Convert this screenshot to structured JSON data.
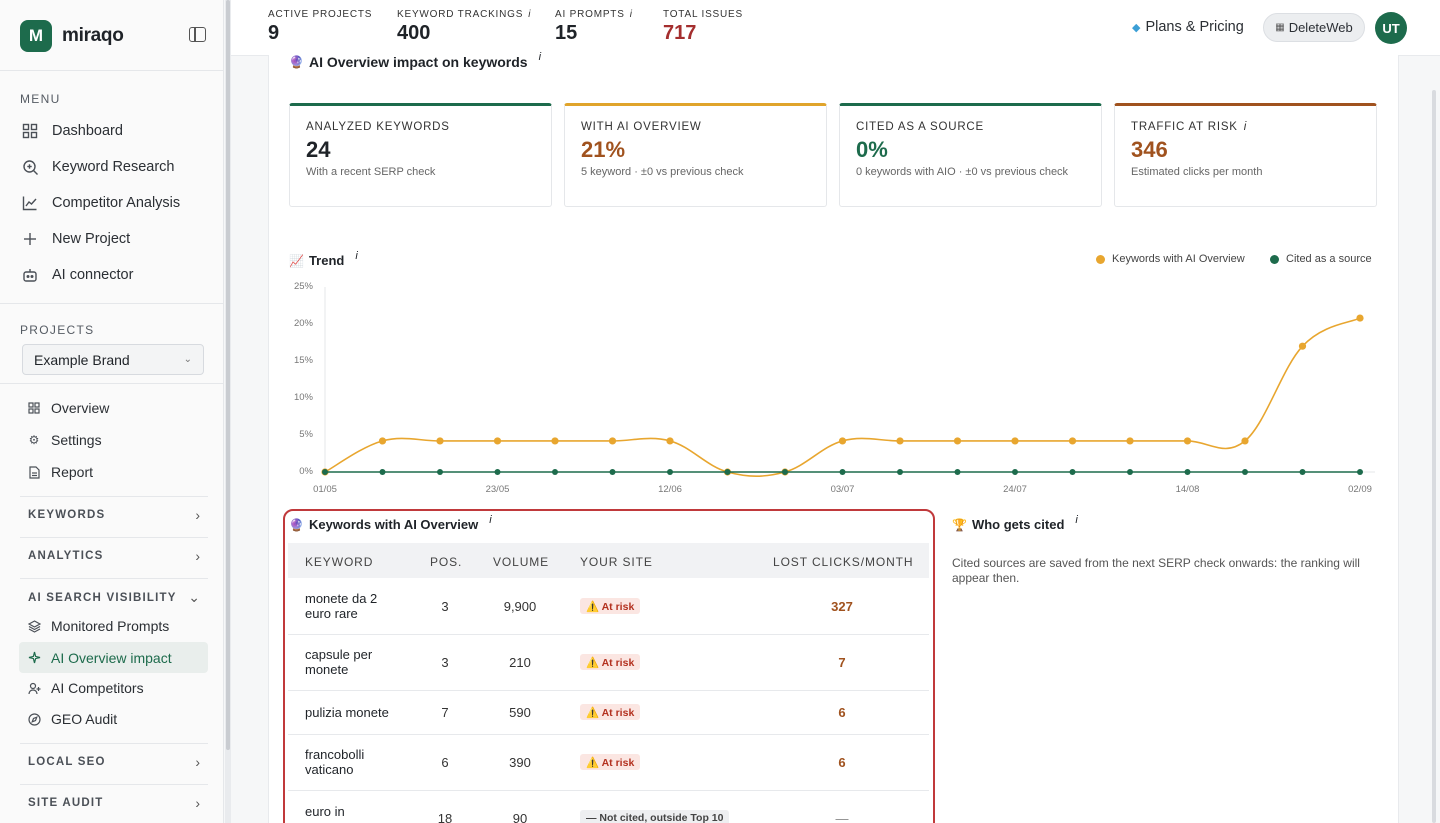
{
  "brand": {
    "name": "miraqo",
    "logo_letter": "M"
  },
  "sidebar": {
    "menu_title": "MENU",
    "menu": [
      {
        "label": "Dashboard",
        "icon": "grid-icon"
      },
      {
        "label": "Keyword Research",
        "icon": "search-icon"
      },
      {
        "label": "Competitor Analysis",
        "icon": "chart-line-icon"
      },
      {
        "label": "New Project",
        "icon": "plus-icon"
      },
      {
        "label": "AI connector",
        "icon": "robot-icon"
      }
    ],
    "projects_title": "PROJECTS",
    "project_select": "Example Brand",
    "project_items": [
      {
        "label": "Overview",
        "icon": "grid-icon"
      },
      {
        "label": "Settings",
        "icon": "gear-icon"
      },
      {
        "label": "Report",
        "icon": "document-icon"
      }
    ],
    "groups": {
      "keywords": "KEYWORDS",
      "analytics": "ANALYTICS",
      "ai_visibility": "AI SEARCH VISIBILITY",
      "local_seo": "LOCAL SEO",
      "site_audit": "SITE AUDIT"
    },
    "ai_items": [
      {
        "label": "Monitored Prompts",
        "icon": "layers-icon"
      },
      {
        "label": "AI Overview impact",
        "icon": "sparkle-icon"
      },
      {
        "label": "AI Competitors",
        "icon": "user-plus-icon"
      },
      {
        "label": "GEO Audit",
        "icon": "compass-icon"
      }
    ]
  },
  "header": {
    "stats": [
      {
        "label": "ACTIVE PROJECTS",
        "value": "9"
      },
      {
        "label": "KEYWORD TRACKINGS",
        "value": "400",
        "info": "i"
      },
      {
        "label": "AI PROMPTS",
        "value": "15",
        "info": "i"
      },
      {
        "label": "TOTAL ISSUES",
        "value": "717"
      }
    ],
    "plans": "Plans & Pricing",
    "site": "DeleteWeb",
    "avatar": "UT"
  },
  "page": {
    "title": "AI Overview impact on keywords",
    "info": "i",
    "cards": [
      {
        "label": "ANALYZED KEYWORDS",
        "value": "24",
        "sub": "With a recent SERP check",
        "color": "#1d6b4c"
      },
      {
        "label": "WITH AI OVERVIEW",
        "value": "21%",
        "sub": "5 keyword · ±0   vs previous check",
        "color": "#e0a42b"
      },
      {
        "label": "CITED AS A SOURCE",
        "value": "0%",
        "sub": "0 keywords with AIO · ±0   vs previous check",
        "color": "#1d6b4c"
      },
      {
        "label": "TRAFFIC AT RISK",
        "value": "346",
        "sub": "Estimated clicks per month",
        "color": "#a0521e",
        "info": "i"
      }
    ]
  },
  "trend": {
    "title": "Trend",
    "info": "i",
    "legend": [
      "Keywords with AI Overview",
      "Cited as a source"
    ],
    "colors": {
      "aio": "#e8a62f",
      "cited": "#1d6b4c"
    }
  },
  "chart_data": {
    "type": "line",
    "title": "Trend",
    "x_tick_labels": [
      "01/05",
      "23/05",
      "12/06",
      "03/07",
      "24/07",
      "14/08",
      "02/09"
    ],
    "y_tick_labels": [
      "0%",
      "5%",
      "10%",
      "15%",
      "20%",
      "25%"
    ],
    "ylim": [
      0,
      25
    ],
    "series": [
      {
        "name": "Keywords with AI Overview",
        "values": [
          0,
          4.2,
          4.2,
          4.2,
          4.2,
          4.2,
          4.2,
          0,
          0,
          4.2,
          4.2,
          4.2,
          4.2,
          4.2,
          4.2,
          4.2,
          4.2,
          17,
          20.8
        ]
      },
      {
        "name": "Cited as a source",
        "values": [
          0,
          0,
          0,
          0,
          0,
          0,
          0,
          0,
          0,
          0,
          0,
          0,
          0,
          0,
          0,
          0,
          0,
          0,
          0
        ]
      }
    ]
  },
  "keywords_table": {
    "title": "Keywords with AI Overview",
    "info": "i",
    "columns": [
      "KEYWORD",
      "POS.",
      "VOLUME",
      "YOUR SITE",
      "LOST CLICKS/MONTH"
    ],
    "rows": [
      {
        "keyword": "monete da 2 euro rare",
        "pos": "3",
        "volume": "9,900",
        "status": "⚠️ At risk",
        "lost": "327"
      },
      {
        "keyword": "capsule per monete",
        "pos": "3",
        "volume": "210",
        "status": "⚠️ At risk",
        "lost": "7"
      },
      {
        "keyword": "pulizia monete",
        "pos": "7",
        "volume": "590",
        "status": "⚠️ At risk",
        "lost": "6"
      },
      {
        "keyword": "francobolli vaticano",
        "pos": "6",
        "volume": "390",
        "status": "⚠️ At risk",
        "lost": "6"
      },
      {
        "keyword": "euro in",
        "pos": "18",
        "volume": "90",
        "status": "— Not cited, outside Top 10",
        "lost": "—"
      }
    ]
  },
  "who_cited": {
    "title": "Who gets cited",
    "info": "i",
    "text": "Cited sources are saved from the next SERP check onwards: the ranking will appear then."
  }
}
